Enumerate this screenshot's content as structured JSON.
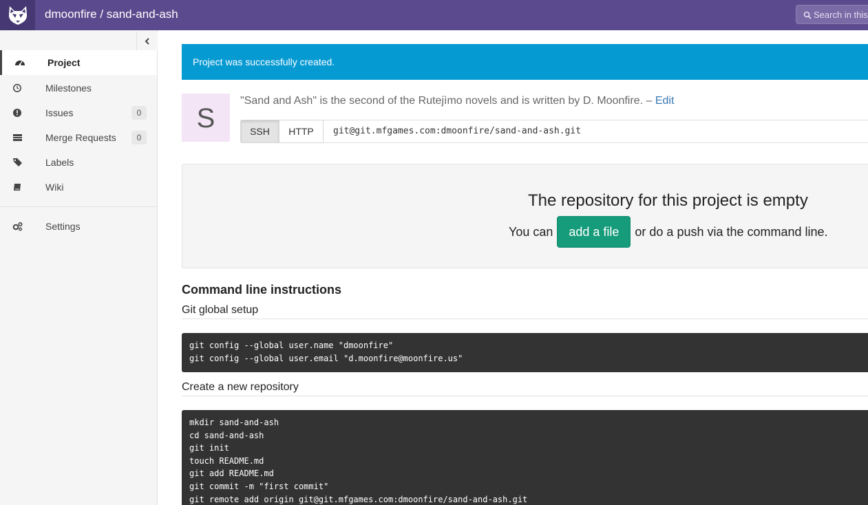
{
  "header": {
    "title": "dmoonfire / sand-and-ash",
    "search_placeholder": "Search in this",
    "logo_icon": "gitlab-fox-logo",
    "search_icon": "search-icon"
  },
  "sidebar": {
    "collapse_icon": "chevron-left-icon",
    "items": [
      {
        "label": "Project",
        "icon": "dashboard-icon",
        "active": true
      },
      {
        "label": "Milestones",
        "icon": "clock-icon"
      },
      {
        "label": "Issues",
        "icon": "exclamation-circle-icon",
        "count": "0"
      },
      {
        "label": "Merge Requests",
        "icon": "list-icon",
        "count": "0"
      },
      {
        "label": "Labels",
        "icon": "tags-icon"
      },
      {
        "label": "Wiki",
        "icon": "book-icon"
      },
      {
        "label": "Settings",
        "icon": "cogs-icon"
      }
    ]
  },
  "flash": {
    "message": "Project was successfully created."
  },
  "project": {
    "avatar_letter": "S",
    "description": "\"Sand and Ash\" is the second of the Rutejìmo novels and is written by D. Moonfire. –",
    "edit_label": "Edit",
    "clone": {
      "ssh_label": "SSH",
      "http_label": "HTTP",
      "url": "git@git.mfgames.com:dmoonfire/sand-and-ash.git"
    }
  },
  "empty_repo": {
    "title": "The repository for this project is empty",
    "prefix": "You can",
    "add_file_label": "add a file",
    "suffix": "or do a push via the command line."
  },
  "instructions": {
    "title": "Command line instructions",
    "sections": [
      {
        "title": "Git global setup",
        "lines": [
          "git config --global user.name \"dmoonfire\"",
          "git config --global user.email \"d.moonfire@moonfire.us\""
        ]
      },
      {
        "title": "Create a new repository",
        "lines": [
          "mkdir sand-and-ash",
          "cd sand-and-ash",
          "git init",
          "touch README.md",
          "git add README.md",
          "git commit -m \"first commit\"",
          "git remote add origin git@git.mfgames.com:dmoonfire/sand-and-ash.git"
        ]
      }
    ]
  },
  "colors": {
    "header": "#5c4a8e",
    "logo_bg": "#463973",
    "flash": "#069ad3",
    "add_file_button": "#169c7b",
    "code_bg": "#333333"
  }
}
